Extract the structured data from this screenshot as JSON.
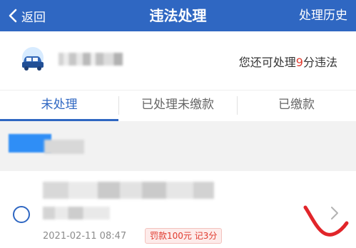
{
  "header": {
    "back_label": "返回",
    "title": "违法处理",
    "history_label": "处理历史"
  },
  "info": {
    "quota_prefix": "您还可处理",
    "quota_num": "9",
    "quota_suffix": "分违法"
  },
  "tabs": [
    {
      "label": "未处理",
      "active": true
    },
    {
      "label": "已处理未缴款",
      "active": false
    },
    {
      "label": "已缴款",
      "active": false
    }
  ],
  "record": {
    "date": "2021-02-11 08:47",
    "fine_tag": "罚款100元 记3分"
  },
  "colors": {
    "primary": "#2f67c2",
    "fine_red": "#e03a2e",
    "annotation": "#e1252a"
  }
}
